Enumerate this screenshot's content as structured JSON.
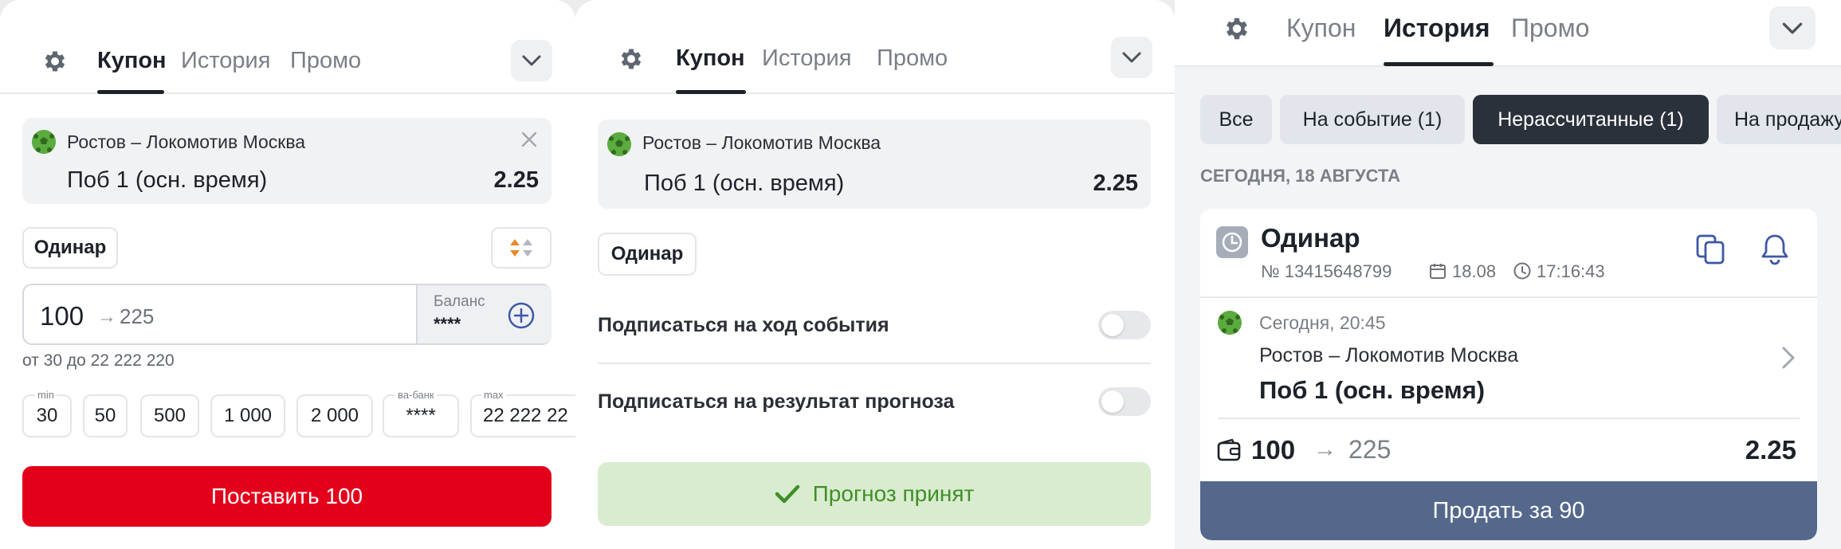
{
  "panel1": {
    "tabs": [
      "Купон",
      "История",
      "Промо"
    ],
    "event": "Ростов – Локомотив Москва",
    "bet": "Поб 1 (осн. время)",
    "odds": "2.25",
    "bet_type": "Одинар",
    "stake": "100",
    "arrow": "→",
    "payout": "225",
    "balance_label": "Баланс",
    "balance_value": "****",
    "range_hint": "от 30 до 22 222 220",
    "quick_stakes": [
      {
        "caption": "min",
        "value": "30"
      },
      {
        "caption": "",
        "value": "50"
      },
      {
        "caption": "",
        "value": "500"
      },
      {
        "caption": "",
        "value": "1 000"
      },
      {
        "caption": "",
        "value": "2 000"
      },
      {
        "caption": "ва-банк",
        "value": "****"
      },
      {
        "caption": "max",
        "value": "22 222 22"
      }
    ],
    "submit": "Поставить 100",
    "accent": "#e3001b"
  },
  "panel2": {
    "tabs": [
      "Купон",
      "История",
      "Промо"
    ],
    "event": "Ростов – Локомотив Москва",
    "bet": "Поб 1 (осн. время)",
    "odds": "2.25",
    "bet_type": "Одинар",
    "subscribe_event": "Подписаться на ход события",
    "subscribe_result": "Подписаться на результат прогноза",
    "accepted": "Прогноз принят",
    "accepted_bg": "#d9ecd0",
    "accepted_fg": "#3f8f26"
  },
  "panel3": {
    "tabs": [
      "Купон",
      "История",
      "Промо"
    ],
    "filters": [
      "Все",
      "На событие (1)",
      "Нерассчитанные (1)",
      "На продажу"
    ],
    "date_header": "СЕГОДНЯ, 18 АВГУСТА",
    "card": {
      "title": "Одинар",
      "number": "№ 13415648799",
      "date": "18.08",
      "time": "17:16:43",
      "event_time": "Сегодня, 20:45",
      "event": "Ростов – Локомотив Москва",
      "bet": "Поб 1 (осн. время)",
      "stake": "100",
      "arrow": "→",
      "payout": "225",
      "odds": "2.25",
      "sell": "Продать за 90",
      "sell_bg": "#54688c"
    }
  }
}
